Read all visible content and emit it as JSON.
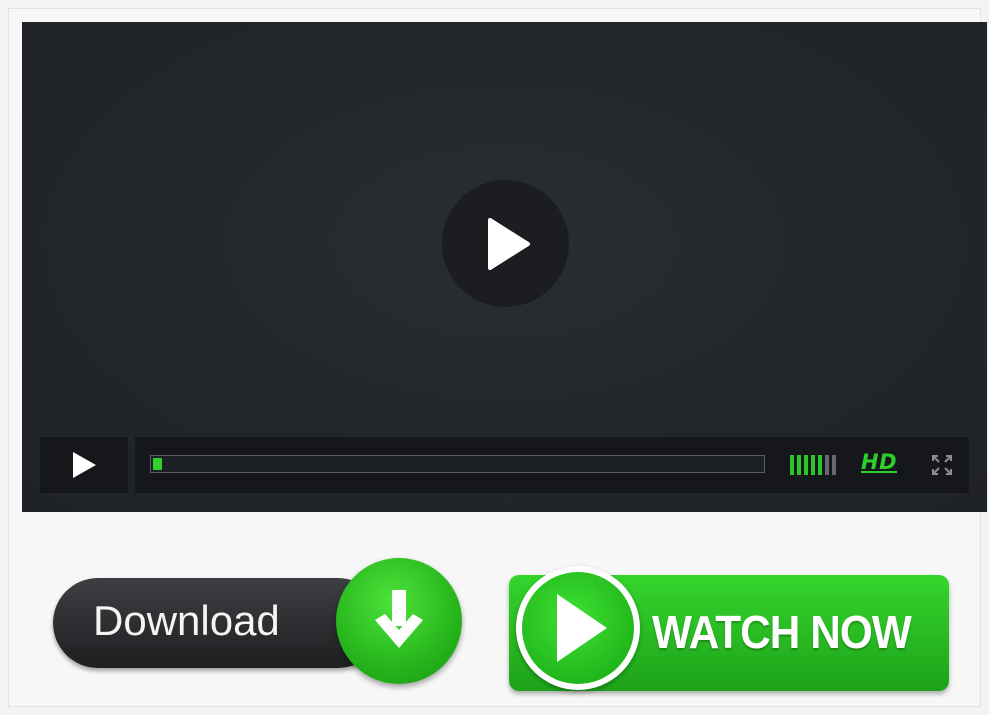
{
  "player": {
    "progress_percent": 1.5,
    "volume_level": 5,
    "volume_max": 7,
    "hd_label": "HD",
    "accent_color": "#2cd02c",
    "icons": {
      "big_play": "play-icon",
      "control_play": "play-icon",
      "fullscreen": "fullscreen-icon"
    }
  },
  "buttons": {
    "download_label": "Download",
    "download_icon": "arrow-down-icon",
    "watch_label": "WATCH NOW",
    "watch_icon": "play-icon"
  }
}
